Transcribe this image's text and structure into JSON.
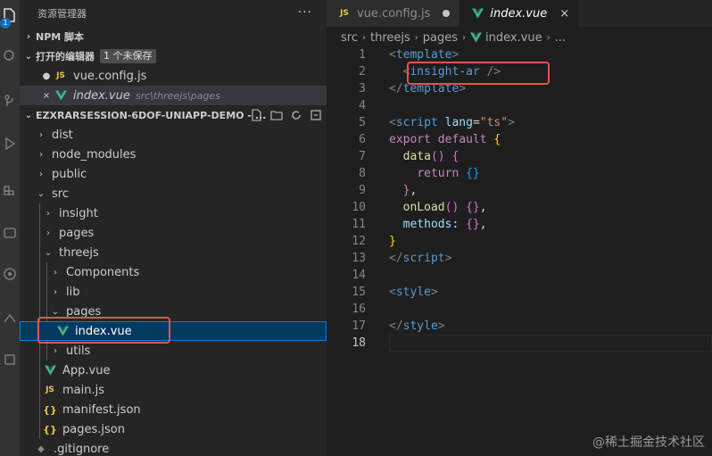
{
  "sidebar": {
    "title": "资源管理器",
    "more_label": "···",
    "npm_section": "NPM 脚本",
    "open_editors": {
      "title": "打开的编辑器",
      "badge": "1 个未保存",
      "items": [
        {
          "name": "vue.config.js",
          "desc": ""
        },
        {
          "name": "index.vue",
          "desc": "src\\threejs\\pages"
        }
      ]
    },
    "project": {
      "title": "EZXRARSESSION-6DOF-UNIAPP-DEMO - ..."
    },
    "tree": [
      {
        "label": "dist"
      },
      {
        "label": "node_modules"
      },
      {
        "label": "public"
      },
      {
        "label": "src"
      },
      {
        "label": "insight"
      },
      {
        "label": "pages"
      },
      {
        "label": "threejs"
      },
      {
        "label": "Components"
      },
      {
        "label": "lib"
      },
      {
        "label": "pages"
      },
      {
        "label": "index.vue"
      },
      {
        "label": "utils"
      },
      {
        "label": "App.vue"
      },
      {
        "label": "main.js"
      },
      {
        "label": "manifest.json"
      },
      {
        "label": "pages.json"
      },
      {
        "label": ".gitignore"
      }
    ]
  },
  "editor": {
    "tabs": [
      {
        "label": "vue.config.js",
        "icon": "JS"
      },
      {
        "label": "index.vue",
        "close": "×"
      }
    ],
    "breadcrumb": [
      "src",
      "threejs",
      "pages",
      "index.vue",
      "..."
    ],
    "lines": [
      {
        "n": "1",
        "t": [
          [
            "tag",
            "<"
          ],
          [
            "tname",
            "template"
          ],
          [
            "tag",
            ">"
          ]
        ]
      },
      {
        "n": "2",
        "t": [
          [
            "plain",
            "  "
          ],
          [
            "tag",
            "<"
          ],
          [
            "tname",
            "insight-ar"
          ],
          [
            "plain",
            " "
          ],
          [
            "tag",
            "/>"
          ]
        ]
      },
      {
        "n": "3",
        "t": [
          [
            "tag",
            "</"
          ],
          [
            "tname",
            "template"
          ],
          [
            "tag",
            ">"
          ]
        ]
      },
      {
        "n": "4",
        "t": []
      },
      {
        "n": "5",
        "t": [
          [
            "tag",
            "<"
          ],
          [
            "tname",
            "script"
          ],
          [
            "plain",
            " "
          ],
          [
            "attr",
            "lang"
          ],
          [
            "plain",
            "="
          ],
          [
            "str",
            "\"ts\""
          ],
          [
            "tag",
            ">"
          ]
        ]
      },
      {
        "n": "6",
        "t": [
          [
            "kw2",
            "export"
          ],
          [
            "plain",
            " "
          ],
          [
            "kw2",
            "default"
          ],
          [
            "plain",
            " "
          ],
          [
            "brace",
            "{"
          ]
        ]
      },
      {
        "n": "7",
        "t": [
          [
            "plain",
            "  "
          ],
          [
            "fn",
            "data"
          ],
          [
            "brace2",
            "()"
          ],
          [
            "plain",
            " "
          ],
          [
            "brace2",
            "{"
          ]
        ]
      },
      {
        "n": "8",
        "t": [
          [
            "plain",
            "    "
          ],
          [
            "kw2",
            "return"
          ],
          [
            "plain",
            " "
          ],
          [
            "brace3",
            "{}"
          ]
        ]
      },
      {
        "n": "9",
        "t": [
          [
            "plain",
            "  "
          ],
          [
            "brace2",
            "}"
          ],
          [
            "plain",
            ","
          ]
        ]
      },
      {
        "n": "10",
        "t": [
          [
            "plain",
            "  "
          ],
          [
            "fn",
            "onLoad"
          ],
          [
            "brace2",
            "()"
          ],
          [
            "plain",
            " "
          ],
          [
            "brace2",
            "{}"
          ],
          [
            "plain",
            ","
          ]
        ]
      },
      {
        "n": "11",
        "t": [
          [
            "plain",
            "  "
          ],
          [
            "prop",
            "methods"
          ],
          [
            "plain",
            ": "
          ],
          [
            "brace2",
            "{}"
          ],
          [
            "plain",
            ","
          ]
        ]
      },
      {
        "n": "12",
        "t": [
          [
            "brace",
            "}"
          ]
        ]
      },
      {
        "n": "13",
        "t": [
          [
            "tag",
            "</"
          ],
          [
            "tname",
            "script"
          ],
          [
            "tag",
            ">"
          ]
        ]
      },
      {
        "n": "14",
        "t": []
      },
      {
        "n": "15",
        "t": [
          [
            "tag",
            "<"
          ],
          [
            "tname",
            "style"
          ],
          [
            "tag",
            ">"
          ]
        ]
      },
      {
        "n": "16",
        "t": []
      },
      {
        "n": "17",
        "t": [
          [
            "tag",
            "</"
          ],
          [
            "tname",
            "style"
          ],
          [
            "tag",
            ">"
          ]
        ]
      },
      {
        "n": "18",
        "t": []
      }
    ]
  },
  "watermark": "@稀土掘金技术社区",
  "colors": {
    "vue_green": "#41b883",
    "vue_dark": "#35495e",
    "highlight_red": "#e05454",
    "selection": "#04395e"
  }
}
